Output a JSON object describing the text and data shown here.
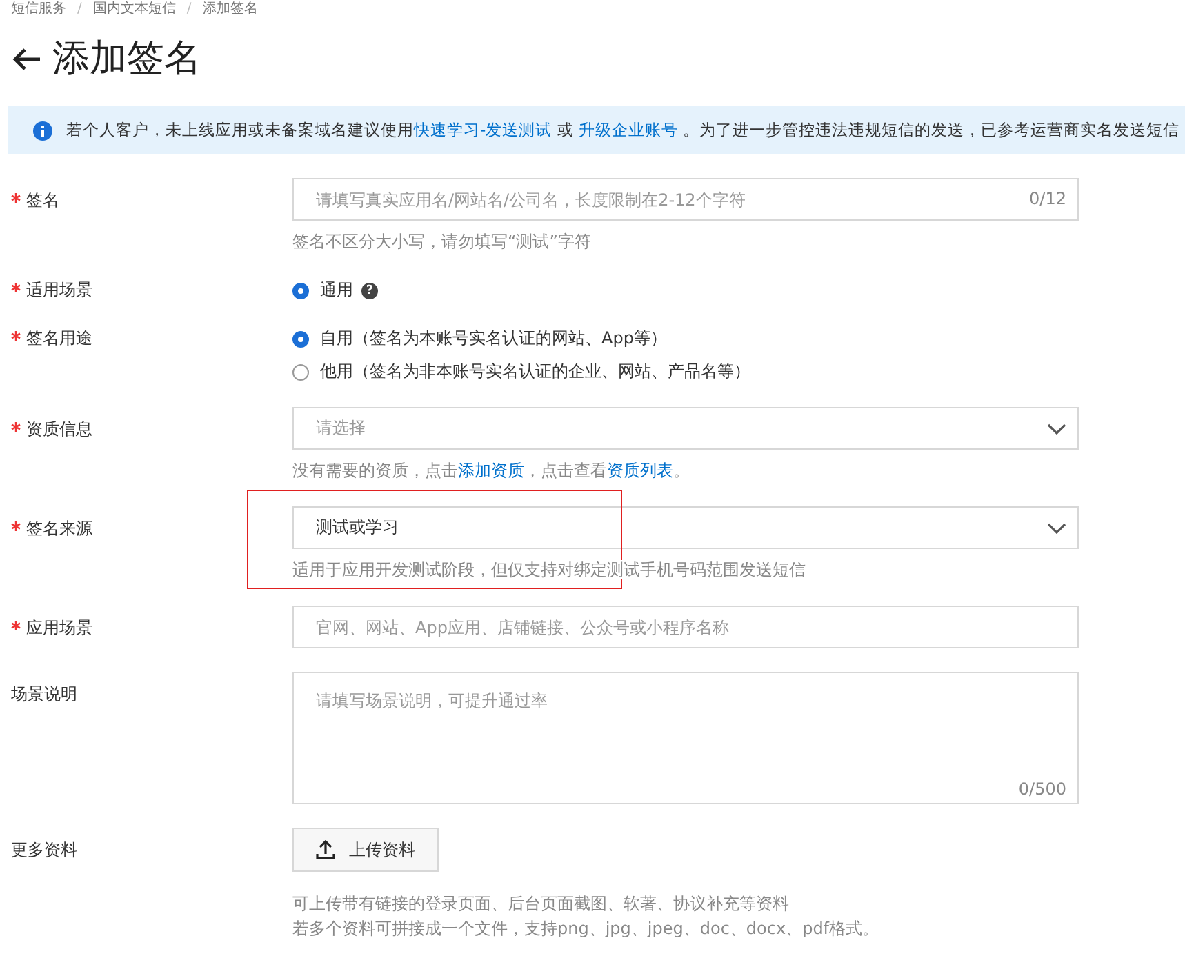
{
  "breadcrumb": {
    "separator": "/",
    "items": [
      "短信服务",
      "国内文本短信",
      "添加签名"
    ]
  },
  "title": "添加签名",
  "notice": [
    {
      "kind": "text",
      "text": "若个人客户，未上线应用或未备案域名建议使用"
    },
    {
      "kind": "link",
      "text": "快速学习-发送测试"
    },
    {
      "kind": "text",
      "text": " 或 "
    },
    {
      "kind": "link",
      "text": "升级企业账号"
    },
    {
      "kind": "text",
      "text": " 。为了进一步管控违法违规短信的发送，已参考运营商实名发送短信"
    }
  ],
  "fields": [
    {
      "kind": "input",
      "label": "签名",
      "required": true,
      "highlighted": false,
      "placeholder": "请填写真实应用名/网站名/公司名，长度限制在2-12个字符",
      "counter": "0/12",
      "hint": [
        [
          {
            "kind": "text",
            "text": "签名不区分大小写，请勿填写“测试”字符"
          }
        ]
      ]
    },
    {
      "kind": "radio",
      "label": "适用场景",
      "required": true,
      "highlighted": false,
      "options": [
        {
          "label": "通用",
          "help": "?",
          "selected": true
        }
      ]
    },
    {
      "kind": "radio",
      "label": "签名用途",
      "required": true,
      "highlighted": false,
      "options": [
        {
          "label": "自用",
          "note": "（签名为本账号实名认证的网站、App等）",
          "selected": true
        },
        {
          "label": "他用",
          "note": "（签名为非本账号实名认证的企业、网站、产品名等）",
          "selected": false
        }
      ]
    },
    {
      "kind": "select",
      "label": "资质信息",
      "required": true,
      "highlighted": false,
      "placeholder": "请选择",
      "hint": [
        [
          {
            "kind": "text",
            "text": "没有需要的资质，点击"
          },
          {
            "kind": "link",
            "text": "添加资质"
          },
          {
            "kind": "text",
            "text": "，点击查看"
          },
          {
            "kind": "link",
            "text": "资质列表"
          },
          {
            "kind": "text",
            "text": "。"
          }
        ]
      ]
    },
    {
      "kind": "select",
      "label": "签名来源",
      "required": true,
      "highlighted": true,
      "value": "测试或学习",
      "hint": [
        [
          {
            "kind": "text",
            "text": "适用于应用开发测试阶段，但仅支持对绑定测试手机号码范围发送短信"
          }
        ]
      ]
    },
    {
      "kind": "input",
      "label": "应用场景",
      "required": true,
      "highlighted": false,
      "placeholder": "官网、网站、App应用、店铺链接、公众号或小程序名称"
    },
    {
      "kind": "textarea",
      "label": "场景说明",
      "required": false,
      "highlighted": false,
      "placeholder": "请填写场景说明，可提升通过率",
      "counter": "0/500"
    },
    {
      "kind": "upload",
      "label": "更多资料",
      "required": false,
      "highlighted": false,
      "button": "上传资料",
      "hint": [
        [
          {
            "kind": "text",
            "text": "可上传带有链接的登录页面、后台页面截图、软著、协议补充等资料"
          }
        ],
        [
          {
            "kind": "text",
            "text": "若多个资料可拼接成一个文件，支持png、jpg、jpeg、doc、docx、pdf格式。"
          }
        ]
      ]
    }
  ]
}
